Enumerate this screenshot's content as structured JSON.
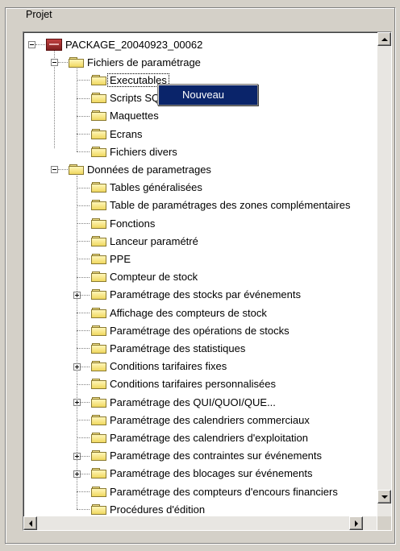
{
  "group": {
    "label": "Projet"
  },
  "tree": {
    "root": "PACKAGE_20040923_00062",
    "group1": {
      "label": "Fichiers de paramétrage",
      "children": [
        "Executables",
        "Scripts SQL",
        "Maquettes",
        "Ecrans",
        "Fichiers divers"
      ]
    },
    "group2": {
      "label": "Données de parametrages",
      "children": [
        "Tables généralisées",
        "Table de paramétrages des zones complémentaires",
        "Fonctions",
        "Lanceur paramétré",
        "PPE",
        "Compteur de stock",
        "Paramétrage des stocks par événements",
        "Affichage des compteurs de stock",
        "Paramétrage des opérations de stocks",
        "Paramétrage des statistiques",
        "Conditions tarifaires fixes",
        "Conditions tarifaires personnalisées",
        "Paramétrage des QUI/QUOI/QUE...",
        "Paramétrage des calendriers commerciaux",
        "Paramétrage des calendriers d'exploitation",
        "Paramétrage des contraintes sur événements",
        "Paramétrage des blocages sur événements",
        "Paramétrage des compteurs d'encours financiers",
        "Procédures d'édition"
      ]
    },
    "selected": "Executables"
  },
  "context_menu": {
    "item": "Nouveau"
  },
  "icons": {
    "folder": "folder-icon",
    "package": "package-icon",
    "expand": "plus-box-icon",
    "collapse": "minus-box-icon"
  },
  "colors": {
    "menu_highlight": "#0a246a",
    "window_bg": "#d4d0c8",
    "folder": "#f0d860"
  }
}
